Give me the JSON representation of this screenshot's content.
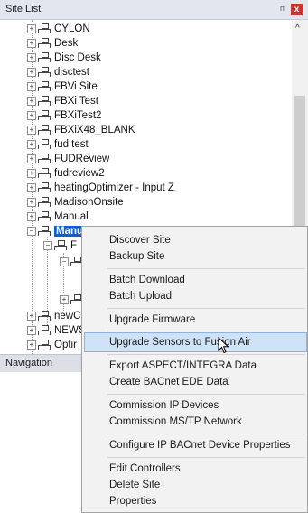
{
  "site_list": {
    "title": "Site List",
    "pin_glyph": "ᴨ",
    "close_glyph": "x",
    "sites": [
      "CYLON",
      "Desk",
      "Disc Desk",
      "disctest",
      "FBVi Site",
      "FBXi Test",
      "FBXiTest2",
      "FBXiX48_BLANK",
      "fud test",
      "FUDReview",
      "fudreview2",
      "heatingOptimizer - Input Z",
      "MadisonOnsite",
      "Manual"
    ],
    "selected_site": "Manual Demo",
    "child_partial": "F",
    "tail_sites": [
      "newC",
      "NEWS",
      "Optir"
    ]
  },
  "navigation": {
    "title": "Navigation"
  },
  "context_menu": {
    "items": [
      "Discover Site",
      "Backup Site",
      "Batch Download",
      "Batch Upload",
      "Upgrade Firmware",
      "Upgrade Sensors to Fusion Air",
      "Export ASPECT/INTEGRA Data",
      "Create BACnet EDE Data",
      "Commission IP Devices",
      "Commission MS/TP Network",
      "Configure IP BACnet Device Properties",
      "Edit Controllers",
      "Delete Site",
      "Properties"
    ],
    "highlighted": "Upgrade Sensors to Fusion Air"
  }
}
